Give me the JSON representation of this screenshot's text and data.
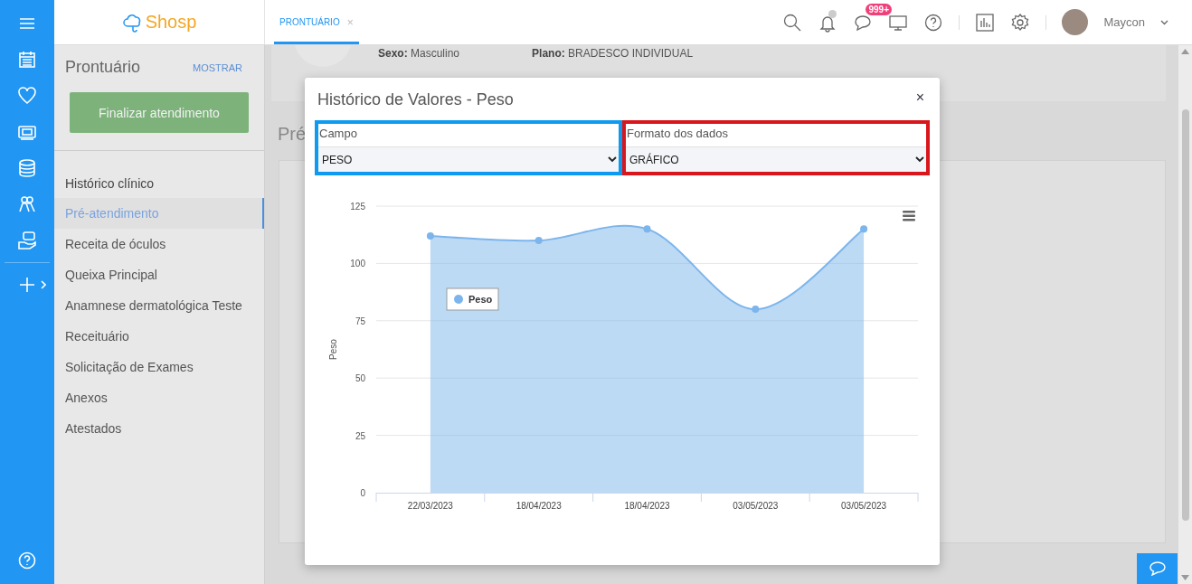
{
  "header": {
    "logo": "Shosp",
    "tabs": [
      {
        "label": "PRONTUÁRIO",
        "selected": true,
        "close": "×"
      }
    ],
    "messages_badge": "999+",
    "user": {
      "name": "Maycon"
    }
  },
  "sidebar": {
    "title": "Prontuário",
    "toggle": "MOSTRAR",
    "action": "Finalizar atendimento",
    "section": "Histórico clínico",
    "items": [
      {
        "label": "Pré-atendimento",
        "selected": true
      },
      {
        "label": "Receita de óculos",
        "selected": false
      },
      {
        "label": "Queixa Principal",
        "selected": false
      },
      {
        "label": "Anamnese dermatológica Teste",
        "selected": false
      },
      {
        "label": "Receituário",
        "selected": false
      },
      {
        "label": "Solicitação de Exames",
        "selected": false
      },
      {
        "label": "Anexos",
        "selected": false
      },
      {
        "label": "Atestados",
        "selected": false
      }
    ]
  },
  "patient": {
    "fields": [
      {
        "label": "Sexo:",
        "value": "Masculino"
      },
      {
        "label": "Plano:",
        "value": "BRADESCO INDIVIDUAL"
      }
    ]
  },
  "section_title": "Pré",
  "modal": {
    "title": "Histórico de Valores - Peso",
    "close": "×",
    "fields": [
      {
        "label": "Campo",
        "value": "PESO",
        "color": "#0e9af0"
      },
      {
        "label": "Formato dos dados",
        "value": "GRÁFICO",
        "color": "#d9161c"
      }
    ],
    "chart_data": {
      "type": "area",
      "ylabel": "Peso",
      "categories": [
        "22/03/2023",
        "18/04/2023",
        "18/04/2023",
        "03/05/2023",
        "03/05/2023"
      ],
      "series": [
        {
          "name": "Peso",
          "color": "#7cb5ec",
          "values": [
            112,
            110,
            115,
            80,
            115
          ]
        }
      ],
      "ylim": [
        0,
        125
      ],
      "grid": true,
      "yticks": [
        0,
        25,
        50,
        75,
        100,
        125
      ]
    }
  }
}
